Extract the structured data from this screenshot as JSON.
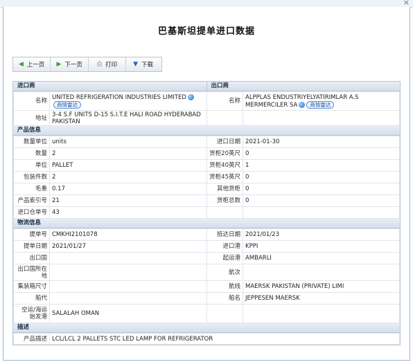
{
  "window": {
    "close_label": "×"
  },
  "page_title": "巴基斯坦提单进口数据",
  "toolbar": {
    "prev": "上一页",
    "next": "下一页",
    "print": "打印",
    "download": "下载"
  },
  "importer": {
    "section": "进口商",
    "name_label": "名称",
    "name": "UNITED REFRIGERATION INDUSTRIES LIMITED",
    "badge": "商情雷达",
    "address_label": "地址",
    "address": "3-4 S.F UNITS D-15 S.I.T.E HALI ROAD HYDERABAD PAKISTAN"
  },
  "exporter": {
    "section": "出口商",
    "name_label": "名称",
    "name": "ALPPLAS ENDUSTRIYELYATIRIMLAR A.S MERMERCILER SA",
    "badge": "商情雷达"
  },
  "product": {
    "section": "产品信息",
    "rows": [
      {
        "l1": "数量单位",
        "v1": "units",
        "l2": "进口日期",
        "v2": "2021-01-30"
      },
      {
        "l1": "数量",
        "v1": "2",
        "l2": "货柜20英尺",
        "v2": "0"
      },
      {
        "l1": "单位",
        "v1": "PALLET",
        "l2": "货柜40英尺",
        "v2": "1"
      },
      {
        "l1": "包装件数",
        "v1": "2",
        "l2": "货柜45英尺",
        "v2": "0"
      },
      {
        "l1": "毛重",
        "v1": "0.17",
        "l2": "其他货柜",
        "v2": "0"
      },
      {
        "l1": "产品索引号",
        "v1": "21",
        "l2": "货柜总数",
        "v2": "0"
      },
      {
        "l1": "进口仓单号",
        "v1": "43",
        "l2": "",
        "v2": ""
      }
    ]
  },
  "logistics": {
    "section": "物流信息",
    "rows": [
      {
        "l1": "提单号",
        "v1": "CMKHI2101078",
        "l2": "抵达日期",
        "v2": "2021/01/23"
      },
      {
        "l1": "提单日期",
        "v1": "2021/01/27",
        "l2": "进口港",
        "v2": "KPPI"
      },
      {
        "l1": "出口国",
        "v1": "",
        "l2": "起运港",
        "v2": "AMBARLI"
      },
      {
        "l1": "出口国所在地",
        "v1": "",
        "l2": "航次",
        "v2": ""
      },
      {
        "l1": "集装箱尺寸",
        "v1": "",
        "l2": "航线",
        "v2": "MAERSK PAKISTAN (PRIVATE) LIMI"
      },
      {
        "l1": "船代",
        "v1": "",
        "l2": "船名",
        "v2": "JEPPESEN MAERSK"
      },
      {
        "l1": "空运/海运始发港",
        "v1": "SALALAH OMAN",
        "l2": "",
        "v2": ""
      }
    ]
  },
  "description": {
    "section": "描述",
    "label": "产品描述",
    "value": "LCL/LCL 2 PALLETS STC LED LAMP FOR REFRIGERATOR"
  }
}
